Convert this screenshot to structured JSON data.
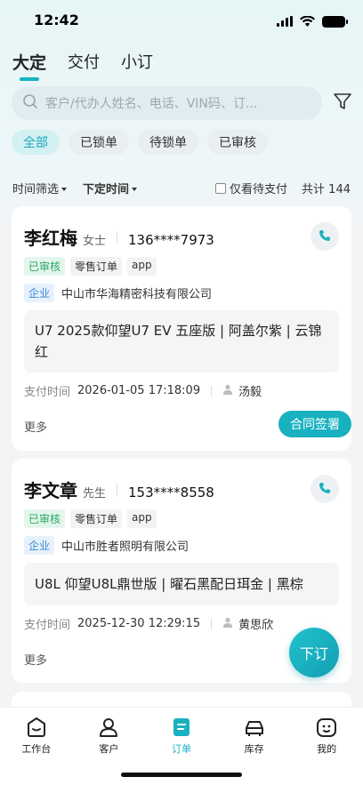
{
  "status": {
    "time": "12:42"
  },
  "tabs": [
    {
      "label": "大定"
    },
    {
      "label": "交付"
    },
    {
      "label": "小订"
    }
  ],
  "search": {
    "placeholder": "客户/代办人姓名、电话、VIN码、订..."
  },
  "chips": [
    {
      "label": "全部"
    },
    {
      "label": "已锁单"
    },
    {
      "label": "待锁单"
    },
    {
      "label": "已审核"
    }
  ],
  "filters": {
    "time_filter": "时间筛选",
    "sort": "下定时间",
    "pending_only": "仅看待支付",
    "total": "共计 144"
  },
  "orders": [
    {
      "name": "李红梅",
      "gender": "女士",
      "phone": "136****7973",
      "tags": [
        "已审核",
        "零售订单",
        "app"
      ],
      "company_tag": "企业",
      "company": "中山市华海精密科技有限公司",
      "vehicle": "U7 2025款仰望U7 EV 五座版 | 阿盖尔紫 | 云锦红",
      "pay_label": "支付时间",
      "pay_time": "2026-01-05 17:18:09",
      "person": "汤毅",
      "more": "更多",
      "action": "合同签署"
    },
    {
      "name": "李文章",
      "gender": "先生",
      "phone": "153****8558",
      "tags": [
        "已审核",
        "零售订单",
        "app"
      ],
      "company_tag": "企业",
      "company": "中山市胜者照明有限公司",
      "vehicle": "U8L 仰望U8L鼎世版 | 曜石黑配日珥金 | 黑棕",
      "pay_label": "支付时间",
      "pay_time": "2025-12-30 12:29:15",
      "person": "黄思欣",
      "more": "更多"
    }
  ],
  "fab": {
    "label": "下订"
  },
  "tabbar": [
    {
      "label": "工作台",
      "icon": "workbench-icon"
    },
    {
      "label": "客户",
      "icon": "customer-icon"
    },
    {
      "label": "订单",
      "icon": "order-icon"
    },
    {
      "label": "库存",
      "icon": "inventory-car-icon"
    },
    {
      "label": "我的",
      "icon": "profile-icon"
    }
  ],
  "colors": {
    "accent": "#19b1c0",
    "approved": "#29a864",
    "company": "#3a8ad6"
  }
}
